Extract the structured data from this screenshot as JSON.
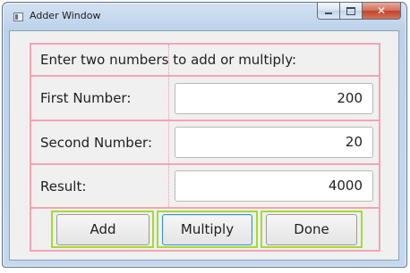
{
  "window": {
    "title": "Adder Window",
    "buttons": {
      "minimize": "minimize-icon",
      "maximize": "maximize-icon",
      "close": "✕"
    }
  },
  "form": {
    "instruction": "Enter two numbers to add or multiply:",
    "first_label": "First Number:",
    "first_value": "200",
    "second_label": "Second Number:",
    "second_value": "20",
    "result_label": "Result:",
    "result_value": "4000"
  },
  "actions": {
    "add": "Add",
    "multiply": "Multiply",
    "done": "Done"
  },
  "colors": {
    "grid_outline": "#f4a4b4",
    "button_cell_outline": "#a6dc2a",
    "focus_border": "#3b8fd4"
  }
}
